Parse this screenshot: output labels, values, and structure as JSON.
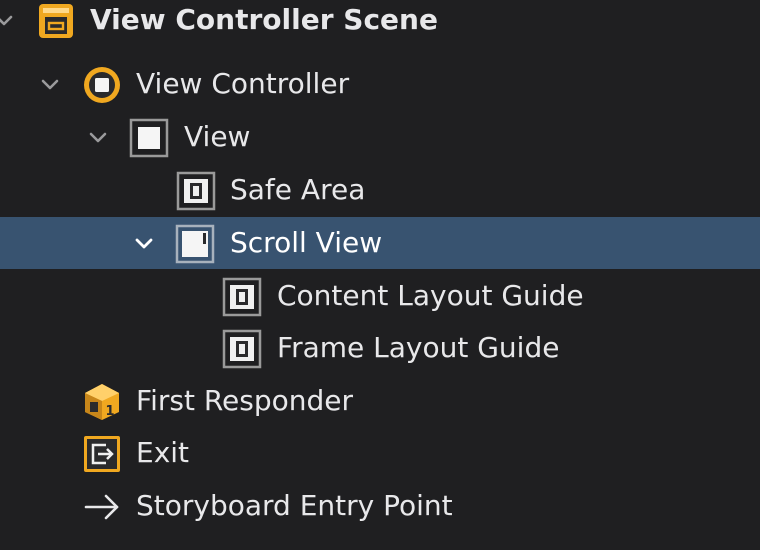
{
  "outline": {
    "scene": {
      "label": "View Controller Scene",
      "icon": "storyboard-scene-icon",
      "expanded": true
    },
    "items": [
      {
        "label": "View Controller",
        "icon": "view-controller-icon",
        "expanded": true
      },
      {
        "label": "View",
        "icon": "view-icon",
        "expanded": true
      },
      {
        "label": "Safe Area",
        "icon": "layout-guide-icon"
      },
      {
        "label": "Scroll View",
        "icon": "scroll-view-icon",
        "expanded": true,
        "selected": true
      },
      {
        "label": "Content Layout Guide",
        "icon": "layout-guide-icon"
      },
      {
        "label": "Frame Layout Guide",
        "icon": "layout-guide-icon"
      },
      {
        "label": "First Responder",
        "icon": "first-responder-icon"
      },
      {
        "label": "Exit",
        "icon": "exit-icon"
      },
      {
        "label": "Storyboard Entry Point",
        "icon": "entry-point-arrow-icon"
      }
    ]
  },
  "colors": {
    "background": "#1f1f21",
    "selection": "#385370",
    "text": "#e8e8ea",
    "accent_orange": "#f0a820",
    "guide_gray": "#9a9a9a"
  }
}
